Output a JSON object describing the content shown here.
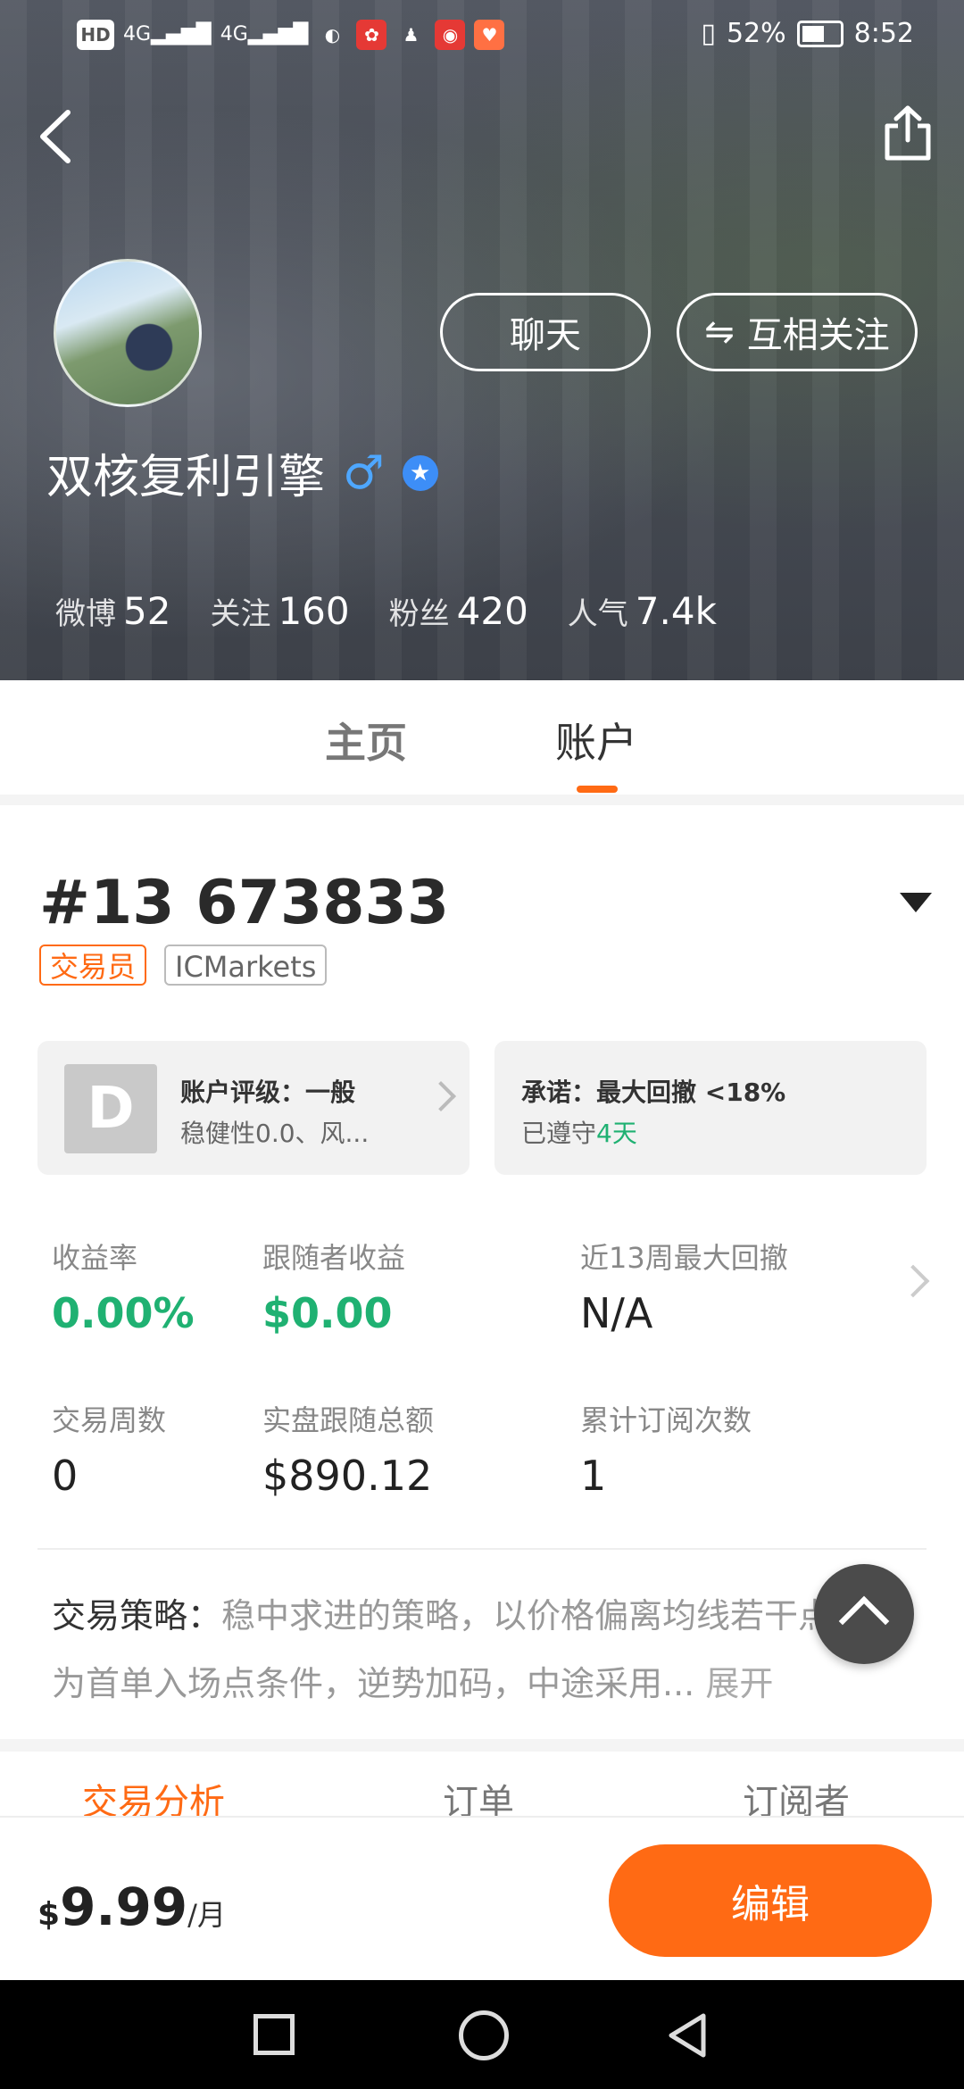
{
  "status_bar": {
    "network_labels": [
      "HD",
      "4G",
      "4G"
    ],
    "battery_percent": "52%",
    "time": "8:52"
  },
  "profile": {
    "name": "双核复利引擎",
    "chat_button": "聊天",
    "follow_button": "互相关注",
    "stats": [
      {
        "label": "微博",
        "value": "52"
      },
      {
        "label": "关注",
        "value": "160"
      },
      {
        "label": "粉丝",
        "value": "420"
      },
      {
        "label": "人气",
        "value": "7.4k"
      }
    ]
  },
  "tabs": {
    "home": "主页",
    "account": "账户"
  },
  "account": {
    "number": "#13 673833",
    "tags": {
      "role": "交易员",
      "broker": "ICMarkets"
    },
    "rating": {
      "grade": "D",
      "title": "账户评级：一般",
      "subtitle": "稳健性0.0、风..."
    },
    "promise": {
      "title": "承诺：最大回撤 <18%",
      "prefix": "已遵守",
      "days": "4天"
    },
    "metrics": [
      {
        "label": "收益率",
        "value": "0.00%"
      },
      {
        "label": "跟随者收益",
        "value": "$0.00"
      },
      {
        "label": "近13周最大回撤",
        "value": "N/A"
      },
      {
        "label": "交易周数",
        "value": "0"
      },
      {
        "label": "实盘跟随总额",
        "value": "$890.12"
      },
      {
        "label": "累计订阅次数",
        "value": "1"
      }
    ],
    "strategy": {
      "key": "交易策略：",
      "text": "稳中求进的策略，以价格偏离均线若干点作为首单入场点条件，逆势加码，中途采用...",
      "more": "展开"
    }
  },
  "sub_tabs": [
    "交易分析",
    "订单",
    "订阅者"
  ],
  "bottom_bar": {
    "currency": "$",
    "price": "9.99",
    "unit": "/月",
    "edit_button": "编辑"
  },
  "colors": {
    "accent": "#ff6a14",
    "positive": "#1fb172",
    "verified": "#3d8ef7",
    "male": "#4ea7ff"
  }
}
